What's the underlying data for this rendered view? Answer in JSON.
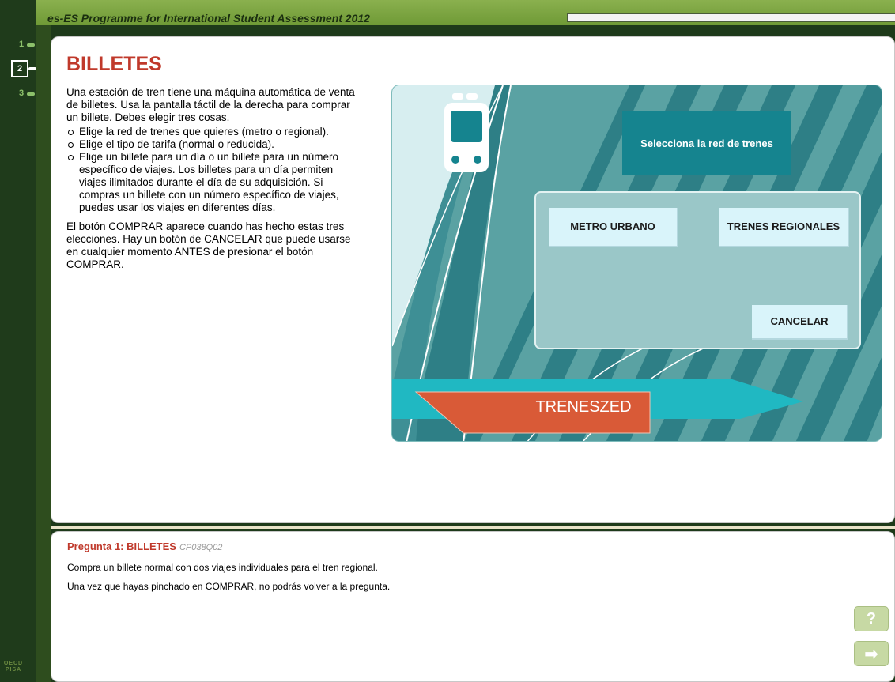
{
  "header": {
    "title": "es-ES Programme for International Student Assessment 2012"
  },
  "nav": {
    "items": [
      {
        "label": "1"
      },
      {
        "label": "2"
      },
      {
        "label": "3"
      }
    ],
    "active_index": 1,
    "logo_text": "OECD PISA"
  },
  "progress": {
    "fraction": 0.0
  },
  "stimulus": {
    "title": "BILLETES",
    "intro": "Una estación de tren tiene una máquina automática de venta de billetes. Usa la pantalla táctil de la derecha para comprar un billete. Debes elegir tres cosas.",
    "bullets": [
      "Elige la red de trenes que quieres (metro o regional).",
      "Elige el tipo de tarifa (normal o reducida).",
      "Elige un billete para un día o un billete para un número específico de viajes. Los billetes para un día permiten viajes ilimitados durante el día de su adquisición. Si compras un billete con un número específico de viajes, puedes usar los viajes en diferentes días."
    ],
    "closing": "El botón COMPRAR aparece cuando has hecho estas tres elecciones. Hay un botón de CANCELAR que puede usarse en cualquier momento ANTES de presionar el botón COMPRAR."
  },
  "machine": {
    "screen_title": "Selecciona la red de trenes",
    "options": {
      "metro": "METRO URBANO",
      "trenes": "TRENES REGIONALES",
      "cancel": "CANCELAR"
    },
    "brand": "TRENESZED",
    "colors": {
      "teal_dark": "#15848f",
      "teal_light": "#5aa2a3",
      "brand_orange": "#d95a37",
      "button_bg": "#d9f4fa"
    }
  },
  "question": {
    "heading": "Pregunta 1: BILLETES",
    "code": "CP038Q02",
    "line1": "Compra un billete normal con dos viajes individuales para el tren regional.",
    "line2": "Una vez que hayas pinchado en COMPRAR, no podrás volver a la pregunta.",
    "help_label": "?",
    "next_label": "➡"
  }
}
